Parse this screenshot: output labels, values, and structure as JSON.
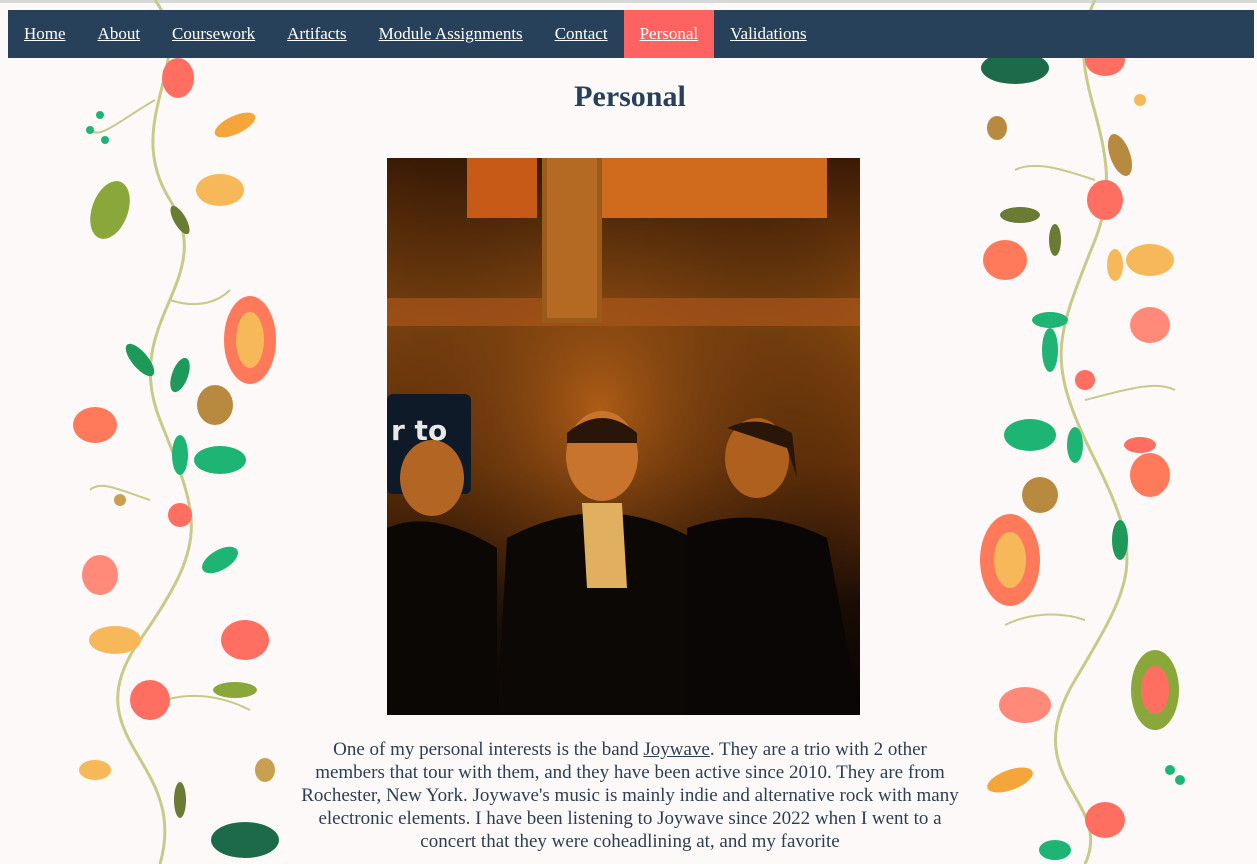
{
  "nav": {
    "items": [
      {
        "label": "Home"
      },
      {
        "label": "About"
      },
      {
        "label": "Coursework"
      },
      {
        "label": "Artifacts"
      },
      {
        "label": "Module Assignments"
      },
      {
        "label": "Contact"
      },
      {
        "label": "Personal",
        "active": true
      },
      {
        "label": "Validations"
      }
    ]
  },
  "page": {
    "title": "Personal",
    "bio": {
      "text_before": "One of my personal interests is the band ",
      "link_text": "Joywave",
      "text_after": ". They are a trio with 2 other members that tour with them, and they have been active since 2010. They are from Rochester, New York. Joywave's music is mainly indie and alternative rock with many electronic elements. I have been listening to Joywave since 2022 when I went to a concert that they were coheadlining at, and my favorite"
    },
    "photo": {
      "sign_text": "r to"
    }
  },
  "colors": {
    "nav_bg": "#27415a",
    "nav_active": "#ff6361",
    "page_bg": "#fdf9f9",
    "text": "#2a3f55"
  }
}
